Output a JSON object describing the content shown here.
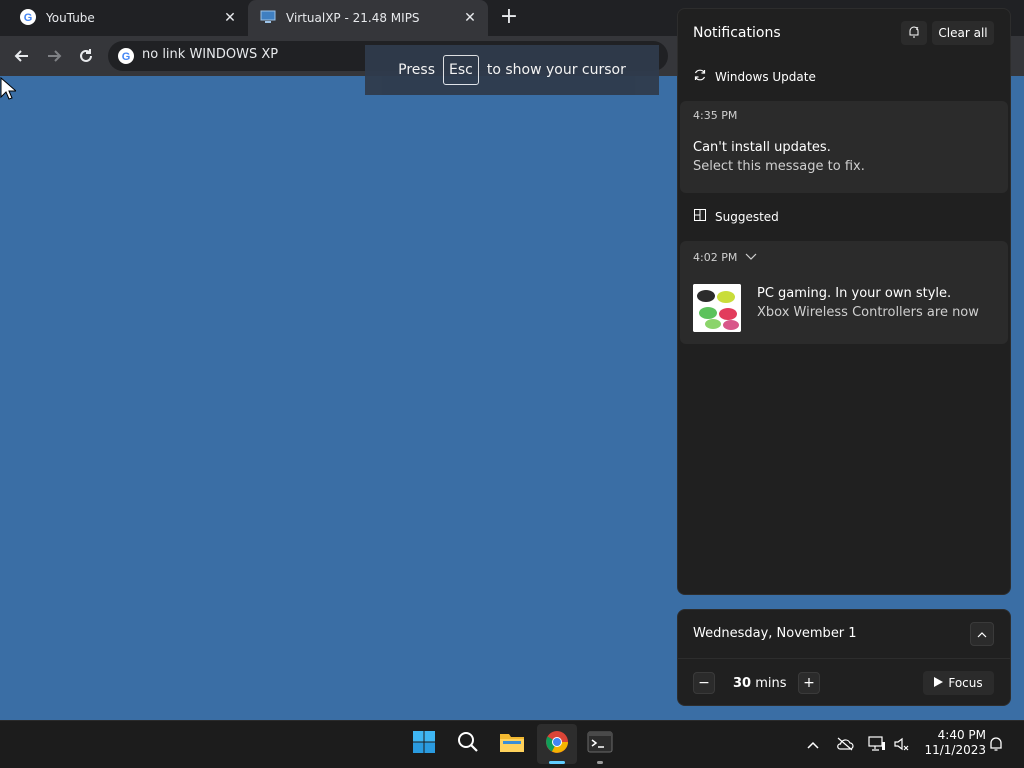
{
  "browser": {
    "tabs": [
      {
        "title": "YouTube",
        "icon": "google-icon",
        "active": false
      },
      {
        "title": "VirtualXP - 21.48 MIPS",
        "icon": "computer-icon",
        "active": true
      }
    ],
    "omnibox_text": "no link WINDOWS XP"
  },
  "esc_banner": {
    "press": "Press",
    "key": "Esc",
    "rest": "to show your cursor"
  },
  "notifications": {
    "title": "Notifications",
    "clear_all": "Clear all",
    "groups": [
      {
        "name": "Windows Update",
        "icon": "refresh-icon",
        "time": "4:35 PM",
        "title": "Can't install updates.",
        "body": "Select this message to fix."
      },
      {
        "name": "Suggested",
        "icon": "tiles-icon",
        "time": "4:02 PM",
        "title": "PC gaming. In your own style.",
        "body": "Xbox Wireless Controllers are now"
      }
    ]
  },
  "calendar": {
    "date": "Wednesday, November 1",
    "focus_value": "30",
    "focus_unit": "mins",
    "focus_button": "Focus"
  },
  "taskbar": {
    "clock_time": "4:40 PM",
    "clock_date": "11/1/2023"
  },
  "colors": {
    "desktop": "#3a6ea5",
    "accent": "#60cdff",
    "panel": "#202020"
  }
}
